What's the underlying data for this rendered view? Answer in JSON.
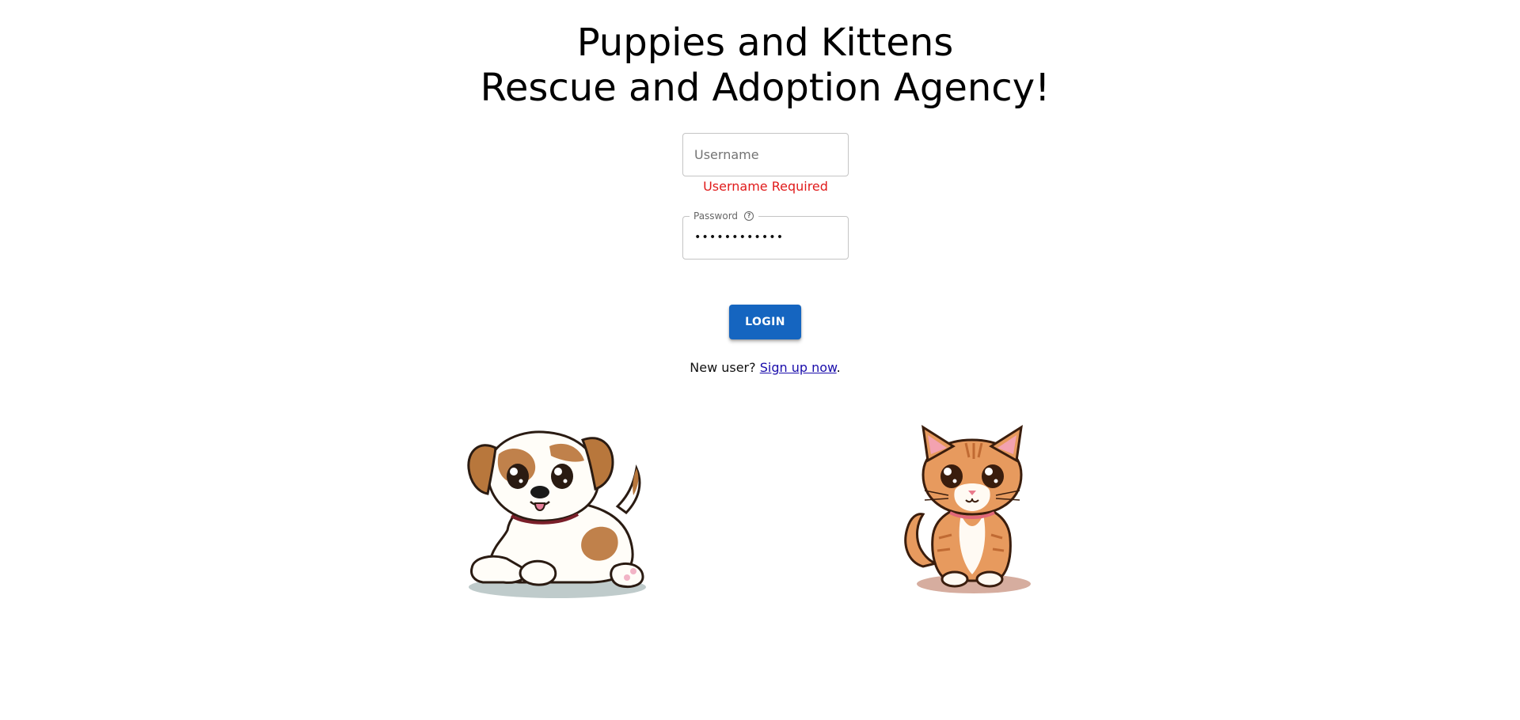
{
  "header": {
    "title_line1": "Puppies and Kittens",
    "title_line2": "Rescue and Adoption Agency!"
  },
  "form": {
    "username": {
      "placeholder": "Username",
      "value": "",
      "error": "Username Required"
    },
    "password": {
      "label": "Password",
      "help_icon": "help-circle-icon",
      "masked_value": "••••••••••••"
    },
    "login_label": "LOGIN"
  },
  "signup": {
    "prefix": "New user? ",
    "link_text": "Sign up now",
    "suffix": "."
  },
  "images": {
    "puppy": "puppy-illustration",
    "kitten": "kitten-illustration"
  },
  "colors": {
    "primary_button": "#1565c0",
    "error_text": "#e01b1b",
    "link": "#1a0dab"
  }
}
